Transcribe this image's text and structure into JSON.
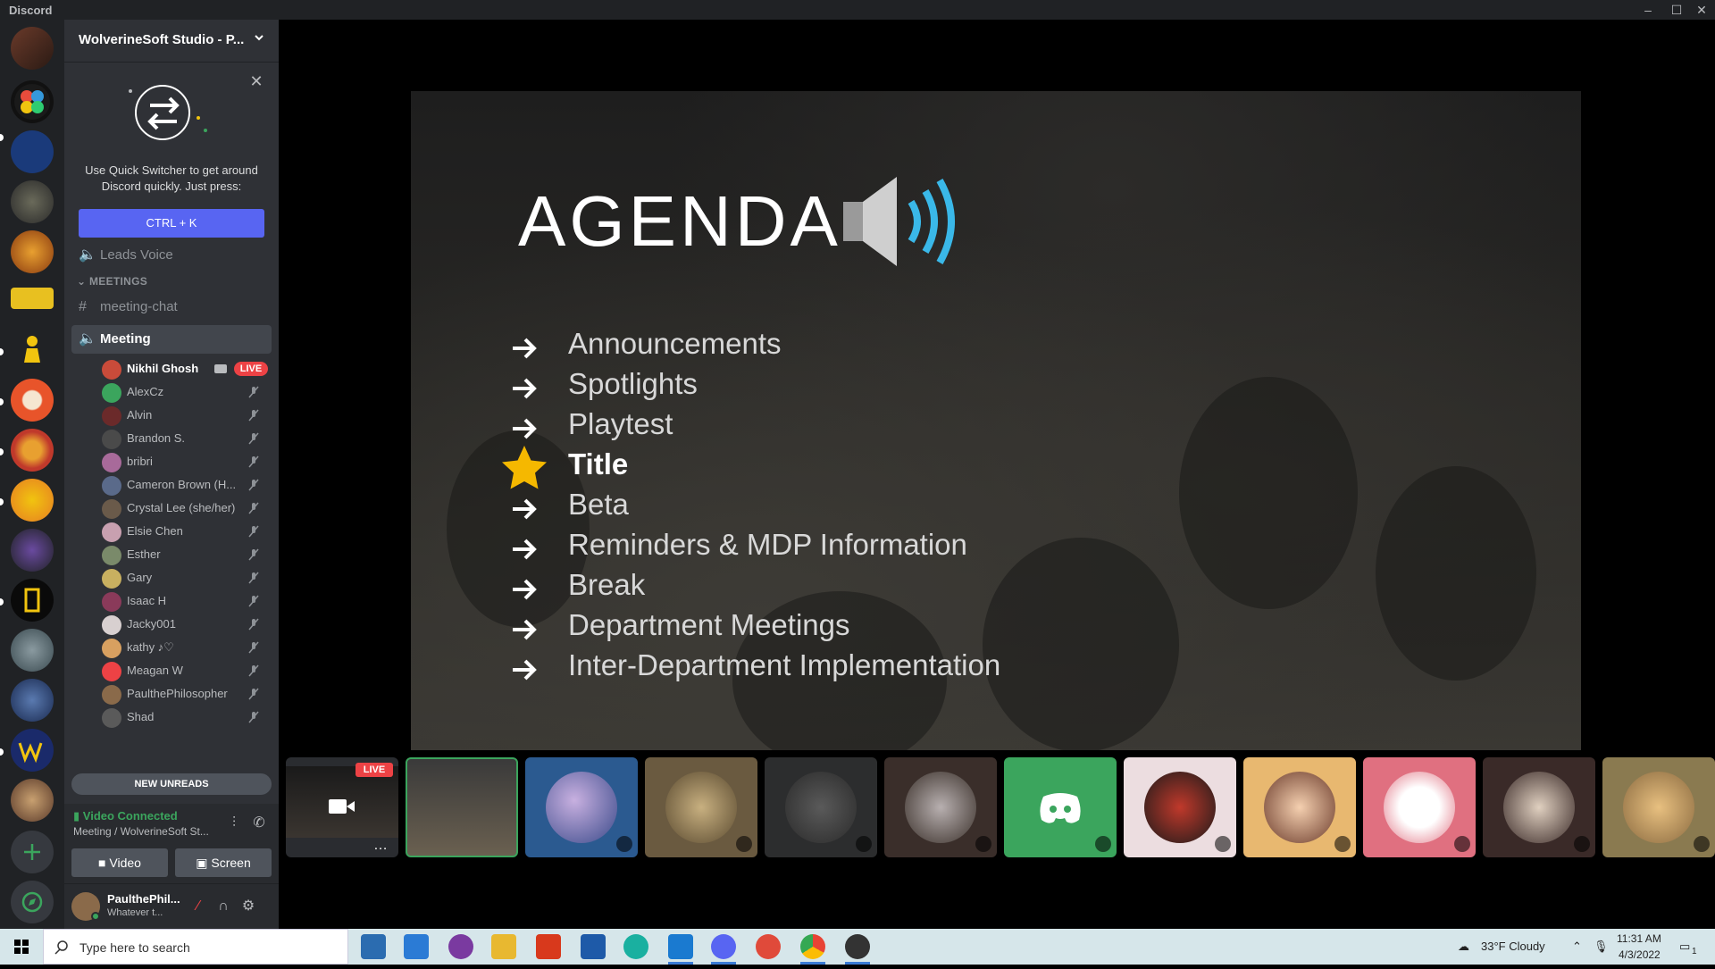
{
  "window": {
    "app_name": "Discord"
  },
  "server": {
    "name": "WolverineSoft Studio - P..."
  },
  "quick_switcher": {
    "text": "Use Quick Switcher to get around Discord quickly. Just press:",
    "button_label": "CTRL + K"
  },
  "channels": {
    "leads_voice": "Leads Voice",
    "category": "MEETINGS",
    "meeting_chat": "meeting-chat",
    "meeting": "Meeting"
  },
  "voice_users": [
    {
      "name": "Nikhil Ghosh",
      "live": "LIVE",
      "color": "#c94b3a"
    },
    {
      "name": "AlexCz",
      "color": "#3ba55d"
    },
    {
      "name": "Alvin",
      "color": "#6b2a2a"
    },
    {
      "name": "Brandon S.",
      "color": "#4a4a4a"
    },
    {
      "name": "bribri",
      "color": "#a86a9a"
    },
    {
      "name": "Cameron Brown (H...",
      "color": "#5a6a8a"
    },
    {
      "name": "Crystal Lee (she/her)",
      "color": "#6a5a4a"
    },
    {
      "name": "Elsie Chen",
      "color": "#c8a0b0"
    },
    {
      "name": "Esther",
      "color": "#7a8a6a"
    },
    {
      "name": "Gary",
      "color": "#c8b060"
    },
    {
      "name": "Isaac H",
      "color": "#8a3a5a"
    },
    {
      "name": "Jacky001",
      "color": "#d8d0d0"
    },
    {
      "name": "kathy ♪♡",
      "color": "#d8a060"
    },
    {
      "name": "Meagan W",
      "color": "#ed4245"
    },
    {
      "name": "PaulthePhilosopher",
      "color": "#8a6a4a"
    },
    {
      "name": "Shad",
      "color": "#5a5a5a"
    }
  ],
  "new_unreads": "NEW UNREADS",
  "voice_connection": {
    "status": "Video Connected",
    "location": "Meeting / WolverineSoft St...",
    "video_label": "Video",
    "screen_label": "Screen"
  },
  "user": {
    "name": "PaulthePhil...",
    "status": "Whatever t..."
  },
  "agenda": {
    "title": "AGENDA",
    "items": [
      "Announcements",
      "Spotlights",
      "Playtest",
      "Title",
      "Beta",
      "Reminders & MDP Information",
      "Break",
      "Department Meetings",
      "Inter-Department Implementation"
    ],
    "current_index": 3
  },
  "tiles": {
    "live_label": "LIVE"
  },
  "taskbar": {
    "search_placeholder": "Type here to search",
    "weather": "33°F  Cloudy",
    "time": "11:31 AM",
    "date": "4/3/2022",
    "notification_count": "1"
  },
  "colors": {
    "blurple": "#5865f2",
    "green": "#3ba55d",
    "live_red": "#ed4245"
  }
}
